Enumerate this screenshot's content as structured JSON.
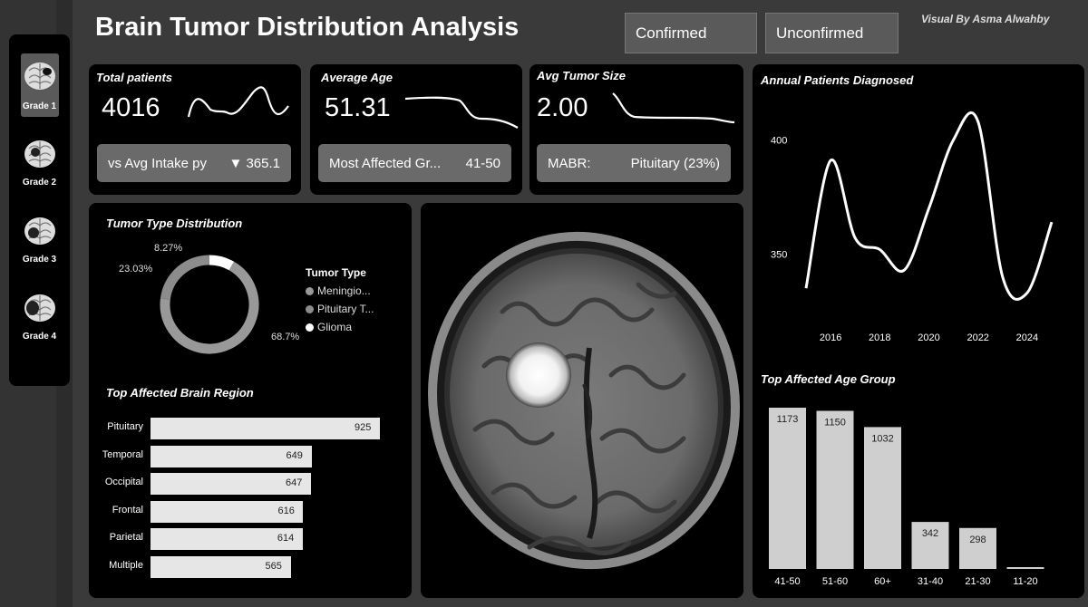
{
  "header": {
    "title": "Brain Tumor Distribution Analysis",
    "filter_confirmed": "Confirmed",
    "filter_unconfirmed": "Unconfirmed",
    "credit": "Visual By Asma Alwahby"
  },
  "grades": [
    {
      "label": "Grade 1",
      "active": true
    },
    {
      "label": "Grade 2",
      "active": false
    },
    {
      "label": "Grade 3",
      "active": false
    },
    {
      "label": "Grade 4",
      "active": false
    }
  ],
  "kpis": {
    "patients": {
      "label": "Total patients",
      "value": "4016",
      "sub_label": "vs Avg Intake py",
      "sub_value": "▼ 365.1"
    },
    "age": {
      "label": "Average Age",
      "value": "51.31",
      "sub_label": "Most Affected Gr...",
      "sub_value": "41-50"
    },
    "tumor": {
      "label": "Avg Tumor Size",
      "value": "2.00",
      "sub_label": "MABR:",
      "sub_value": "Pituitary (23%)"
    }
  },
  "tumor_type": {
    "title": "Tumor Type Distribution",
    "legend_title": "Tumor Type",
    "legend": [
      {
        "name": "Meningio...",
        "color": "#999999"
      },
      {
        "name": "Pituitary T...",
        "color": "#8c8c8c"
      },
      {
        "name": "Glioma",
        "color": "#ffffff"
      }
    ],
    "label_small": "8.27%",
    "label_mid": "23.03%",
    "label_big": "68.7%"
  },
  "region": {
    "title": "Top Affected Brain Region"
  },
  "annual": {
    "title": "Annual Patients Diagnosed"
  },
  "agegroup": {
    "title": "Top Affected Age Group"
  },
  "chart_data": [
    {
      "type": "pie",
      "title": "Tumor Type Distribution",
      "legend_title": "Tumor Type",
      "categories": [
        "Meningio...",
        "Pituitary T...",
        "Glioma"
      ],
      "values": [
        68.7,
        23.03,
        8.27
      ]
    },
    {
      "type": "bar",
      "title": "Top Affected Brain Region",
      "categories": [
        "Pituitary",
        "Temporal",
        "Occipital",
        "Frontal",
        "Parietal",
        "Multiple"
      ],
      "values": [
        925,
        649,
        647,
        616,
        614,
        565
      ]
    },
    {
      "type": "line",
      "title": "Annual Patients Diagnosed",
      "x": [
        2015,
        2016,
        2017,
        2018,
        2019,
        2020,
        2021,
        2022,
        2023,
        2024,
        2025
      ],
      "y": [
        335,
        391,
        357,
        352,
        343,
        370,
        400,
        408,
        340,
        333,
        364
      ],
      "xticks": [
        "2016",
        "2018",
        "2020",
        "2022",
        "2024"
      ],
      "yticks": [
        "350",
        "400"
      ],
      "ylim": [
        320,
        420
      ]
    },
    {
      "type": "bar",
      "title": "Top Affected Age Group",
      "categories": [
        "41-50",
        "51-60",
        "60+",
        "31-40",
        "21-30",
        "11-20"
      ],
      "values": [
        1173,
        1150,
        1032,
        342,
        298,
        11
      ],
      "data_labels": [
        "1173",
        "1150",
        "1032",
        "342",
        "298",
        ""
      ]
    }
  ]
}
